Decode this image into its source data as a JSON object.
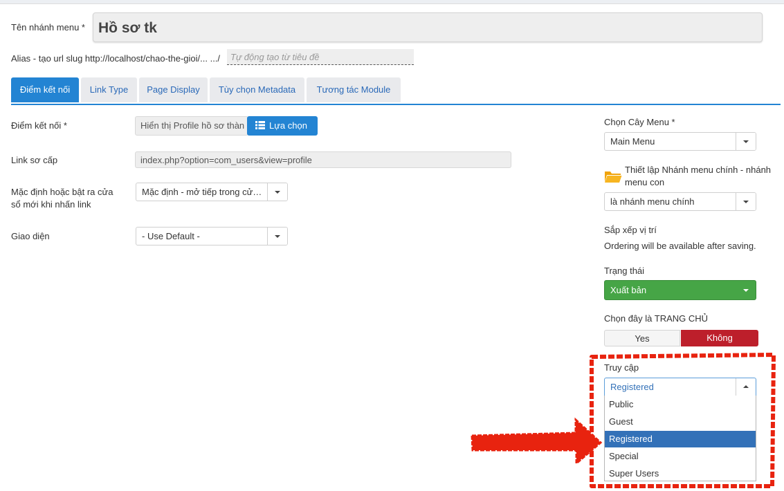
{
  "form": {
    "title_label": "Tên nhánh menu *",
    "title_value": "Hồ sơ tk",
    "alias_label": "Alias - tạo url slug http://localhost/chao-the-gioi/... .../",
    "alias_placeholder": "Tự động tạo từ tiêu đề"
  },
  "tabs": [
    {
      "label": "Điểm kết nối",
      "active": true
    },
    {
      "label": "Link Type"
    },
    {
      "label": "Page Display"
    },
    {
      "label": "Tùy chọn Metadata"
    },
    {
      "label": "Tương tác Module"
    }
  ],
  "details": {
    "endpoint_label": "Điểm kết nối *",
    "endpoint_value": "Hiển thị Profile hồ sơ thàn",
    "select_button": "Lựa chọn",
    "link_label": "Link sơ cấp",
    "link_value": "index.php?option=com_users&view=profile",
    "target_label_1": "Mặc định hoặc bật ra cửa",
    "target_label_2": "sổ mới khi nhấn link",
    "target_value": "Mặc định - mở tiếp trong cửa sổ",
    "template_label": "Giao diện",
    "template_value": "- Use Default -"
  },
  "sidebar": {
    "menu_label": "Chọn Cây Menu *",
    "menu_value": "Main Menu",
    "parent_label_1": "Thiết lập Nhánh menu chính - nhánh",
    "parent_label_2": "menu con",
    "parent_value": "là nhánh menu chính",
    "ordering_label": "Sắp xếp vị trí",
    "ordering_note": "Ordering will be available after saving.",
    "status_label": "Trạng thái",
    "status_value": "Xuất bản",
    "status_color": "#46a546",
    "home_label": "Chọn đây là TRANG CHỦ",
    "home_yes": "Yes",
    "home_no": "Không",
    "home_selected": "Không",
    "access_label": "Truy cập",
    "access_value": "Registered",
    "access_options": [
      "Public",
      "Guest",
      "Registered",
      "Special",
      "Super Users"
    ],
    "access_highlighted": "Registered"
  },
  "annotation": {
    "color": "#e8230f"
  }
}
